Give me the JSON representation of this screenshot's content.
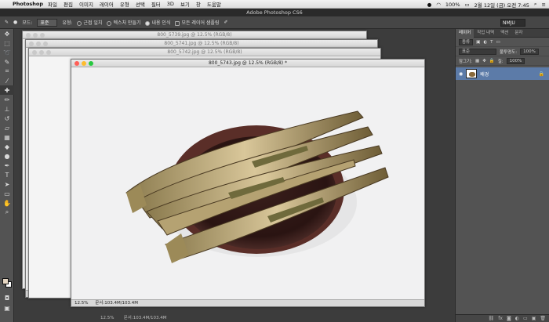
{
  "menubar": {
    "app": "Photoshop",
    "items": [
      "파일",
      "편집",
      "이미지",
      "레이어",
      "유형",
      "선택",
      "필터",
      "3D",
      "보기",
      "창",
      "도움말"
    ],
    "battery": "100%",
    "datetime": "2월 12일 (금) 오전 7:45"
  },
  "window": {
    "title": "Adobe Photoshop CS6"
  },
  "options": {
    "mode_label": "모드:",
    "mode_value": "표준",
    "type_label": "유형:",
    "type_options": [
      "근접 일치",
      "텍스처 만들기",
      "내용 인식",
      "모든 레이어 샘플링"
    ],
    "selected_type": "내용 인식",
    "workspace": "NMJU"
  },
  "documents": [
    {
      "title": "800_5739.jpg @ 12.5% (RGB/8)"
    },
    {
      "title": "800_5741.jpg @ 12.5% (RGB/8)"
    },
    {
      "title": "800_5742.jpg @ 12.5% (RGB/8)"
    },
    {
      "title": "800_5743.jpg @ 12.5% (RGB/8) *"
    }
  ],
  "status": {
    "zoom": "12.5%",
    "doc_size": "문서:103.4M/103.4M",
    "back_zoom": "12.5%",
    "back_doc_size": "문서:103.4M/103.4M"
  },
  "layers_panel": {
    "tabs": [
      "레이어",
      "작업 내역",
      "액션",
      "문자"
    ],
    "active_tab": "레이어",
    "kind_label": "종류",
    "blend_mode": "표준",
    "opacity_label": "불투명도:",
    "opacity_value": "100%",
    "lock_label": "잠그기:",
    "fill_label": "칠:",
    "fill_value": "100%",
    "layer_name": "배경"
  },
  "colors": {
    "accent": "#5c7ba8"
  }
}
